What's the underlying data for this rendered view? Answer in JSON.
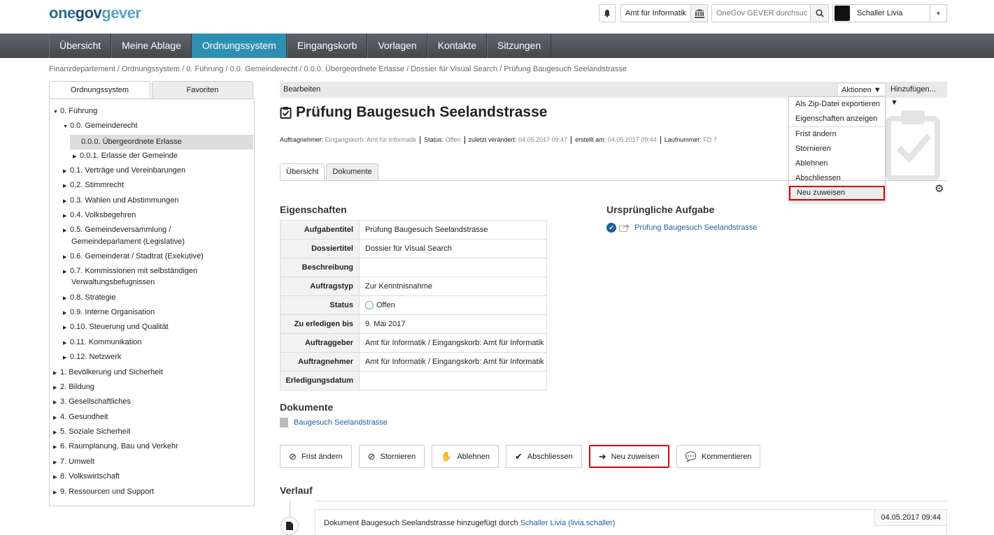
{
  "header": {
    "logo": {
      "one": "one",
      "gov": "gov",
      "gever": "gever"
    },
    "org_unit": "Amt für Informatik",
    "search_placeholder": "OneGov GEVER durchsuc",
    "user_name": "Schaller Livia"
  },
  "nav": [
    "Übersicht",
    "Meine Ablage",
    "Ordnungssystem",
    "Eingangskorb",
    "Vorlagen",
    "Kontakte",
    "Sitzungen"
  ],
  "breadcrumb": "Finanzdepartement / Ordnungssystem / 0. Führung / 0.0. Gemeinderecht / 0.0.0. Übergeordnete Erlasse / Dossier für Visual Search / Prüfung Baugesuch Seelandstrasse",
  "sidebar": {
    "tabs": [
      "Ordnungssystem",
      "Favoriten"
    ],
    "tree": [
      "0. Führung",
      "0.0. Gemeinderecht",
      "0.0.0. Übergeordnete Erlasse",
      "0.0.1. Erlasse der Gemeinde",
      "0.1. Verträge und Vereinbarungen",
      "0.2. Stimmrecht",
      "0.3. Wahlen und Abstimmungen",
      "0.4. Volksbegehren",
      "0.5. Gemeindeversammlung /",
      "Gemeindeparlament (Legislative)",
      "0.6. Gemeinderat / Stadtrat (Exekutive)",
      "0.7. Kommissionen mit selbständigen",
      "Verwaltungsbefugnissen",
      "0.8. Strategie",
      "0.9. Interne Organisation",
      "0.10. Steuerung und Qualität",
      "0.11. Kommunikation",
      "0.12. Netzwerk",
      "1. Bevölkerung und Sicherheit",
      "2. Bildung",
      "3. Gesellschaftliches",
      "4. Gesundheit",
      "5. Soziale Sicherheit",
      "6. Raumplanung, Bau und Verkehr",
      "7. Umwelt",
      "8. Volkswirtschaft",
      "9. Ressourcen und Support"
    ]
  },
  "toolbar": {
    "edit": "Bearbeiten",
    "actions": "Aktionen ▼",
    "add": "Hinzufügen... ▼"
  },
  "dropdown": [
    "Als Zip-Datei exportieren",
    "Eigenschaften anzeigen",
    "Frist ändern",
    "Stornieren",
    "Ablehnen",
    "Abschliessen",
    "Neu zuweisen"
  ],
  "title": "Prüfung Baugesuch Seelandstrasse",
  "meta": {
    "auftragnehmer_label": "Auftragnehmer:",
    "auftragnehmer": "Eingangskorb: Amt für Informatik",
    "status_label": "Status:",
    "status": "Offen",
    "changed_label": "zuletzt verändert:",
    "changed": "04.05.2017 09:47",
    "created_label": "erstellt am:",
    "created": "04.05.2017 09:44",
    "number_label": "Laufnummer:",
    "number": "FD 7"
  },
  "content_tabs": [
    "Übersicht",
    "Dokumente"
  ],
  "properties": {
    "heading": "Eigenschaften",
    "rows": [
      {
        "k": "Aufgabentitel",
        "v": "Prüfung Baugesuch Seelandstrasse"
      },
      {
        "k": "Dossiertitel",
        "v": "Dossier für Visual Search"
      },
      {
        "k": "Beschreibung",
        "v": ""
      },
      {
        "k": "Auftragstyp",
        "v": "Zur Kenntnisnahme"
      },
      {
        "k": "Status",
        "v": "Offen"
      },
      {
        "k": "Zu erledigen bis",
        "v": "9. Mai 2017"
      },
      {
        "k": "Auftraggeber",
        "v": "Amt für Informatik / Eingangskorb: Amt für Informatik"
      },
      {
        "k": "Auftragnehmer",
        "v": "Amt für Informatik / Eingangskorb: Amt für Informatik"
      },
      {
        "k": "Erledigungsdatum",
        "v": ""
      }
    ]
  },
  "original_task": {
    "heading": "Ursprüngliche Aufgabe",
    "link": "Prüfung Baugesuch Seelandstrasse"
  },
  "documents": {
    "heading": "Dokumente",
    "item": "Baugesuch Seelandstrasse"
  },
  "actions": [
    "Frist ändern",
    "Stornieren",
    "Ablehnen",
    "Abschliessen",
    "Neu zuweisen",
    "Kommentieren"
  ],
  "history": {
    "heading": "Verlauf",
    "text": "Dokument Baugesuch Seelandstrasse hinzugefügt durch",
    "user_link": "Schaller Livia (livia.schaller)",
    "timestamp": "04.05.2017 09:44"
  },
  "colors": {
    "nav_active": "#2e8fb3",
    "highlight": "#d9000d",
    "link": "#1f5f9b"
  }
}
